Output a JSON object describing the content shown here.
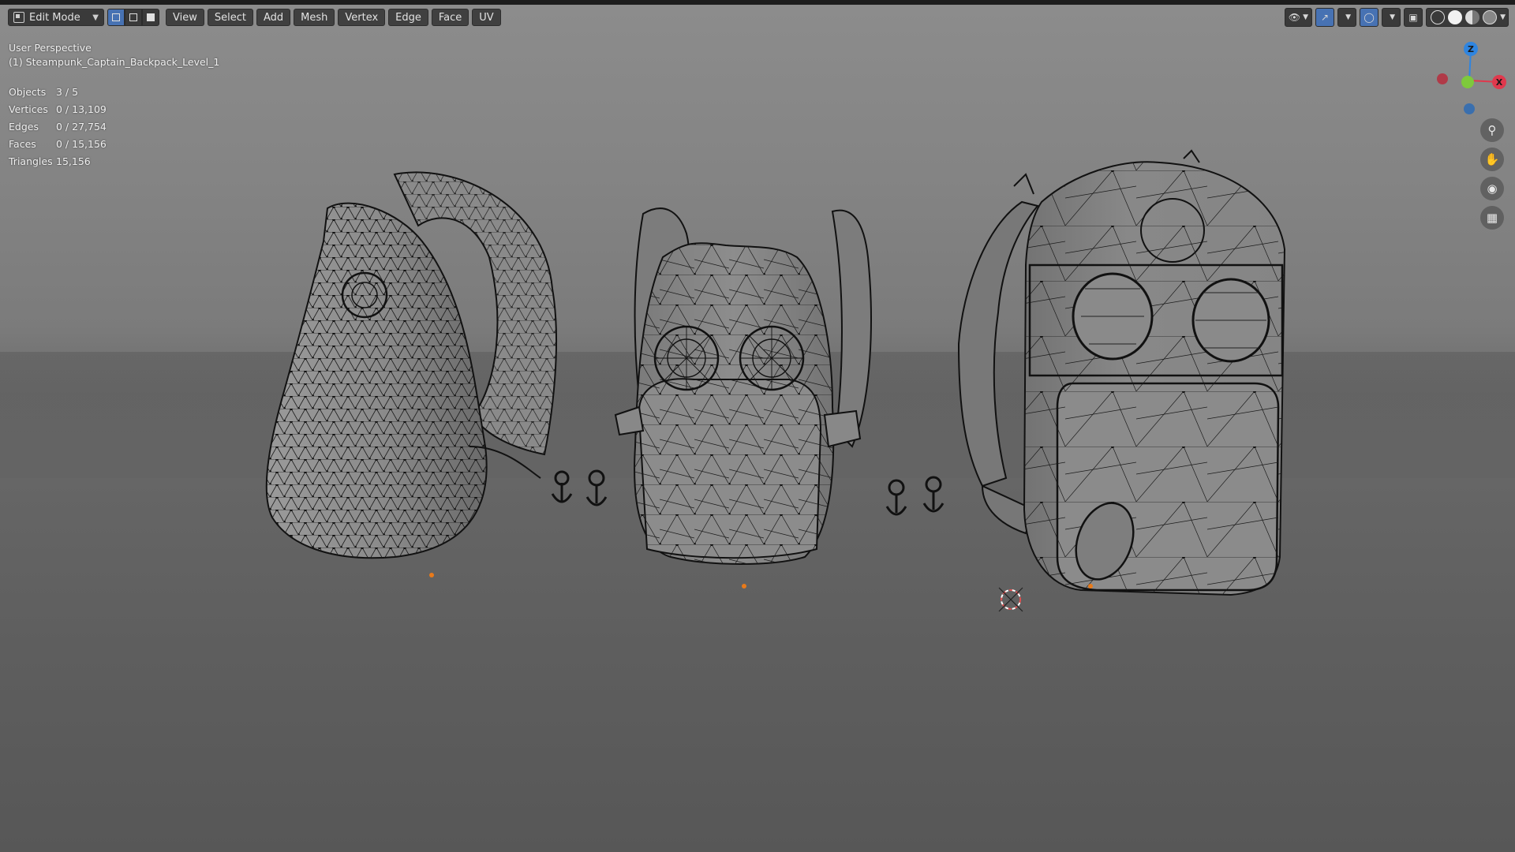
{
  "header": {
    "mode": "Edit Mode",
    "menus": [
      "View",
      "Select",
      "Add",
      "Mesh",
      "Vertex",
      "Edge",
      "Face",
      "UV"
    ]
  },
  "viewport_info": {
    "perspective": "User Perspective",
    "active_object": "(1) Steampunk_Captain_Backpack_Level_1"
  },
  "stats": [
    {
      "label": "Objects",
      "value": "3 / 5"
    },
    {
      "label": "Vertices",
      "value": "0 / 13,109"
    },
    {
      "label": "Edges",
      "value": "0 / 27,754"
    },
    {
      "label": "Faces",
      "value": "0 / 15,156"
    },
    {
      "label": "Triangles",
      "value": "15,156"
    }
  ],
  "gizmo": {
    "z_label": "Z",
    "x_label": "X",
    "y_label": "Y"
  },
  "colors": {
    "x_axis": "#e0394d",
    "y_axis": "#7ec93c",
    "z_axis": "#2f85e0",
    "active_select_mode": "#4772b3",
    "origin_dot": "#e87a1a"
  }
}
